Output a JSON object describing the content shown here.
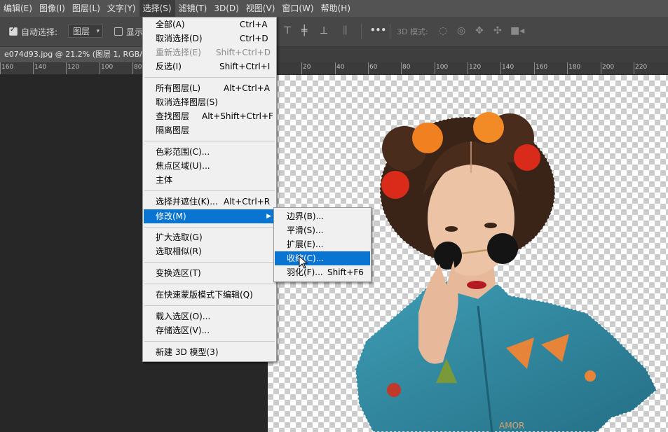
{
  "menubar": [
    "编辑(E)",
    "图像(I)",
    "图层(L)",
    "文字(Y)",
    "选择(S)",
    "滤镜(T)",
    "3D(D)",
    "视图(V)",
    "窗口(W)",
    "帮助(H)"
  ],
  "options": {
    "auto_select_label": "自动选择:",
    "layer_dropdown": "图层",
    "show_label": "显示",
    "mode_3d_label": "3D 模式:",
    "more": "•••"
  },
  "doc_tab": "e074d93.jpg @ 21.2% (图层 1, RGB/8) *",
  "ruler": {
    "left": [
      "160",
      "140",
      "120",
      "100",
      "80"
    ],
    "right": [
      "20",
      "40",
      "60",
      "80",
      "100",
      "120",
      "140",
      "160",
      "180",
      "200",
      "220"
    ]
  },
  "select_menu": {
    "items": [
      {
        "label": "全部(A)",
        "shortcut": "Ctrl+A"
      },
      {
        "label": "取消选择(D)",
        "shortcut": "Ctrl+D"
      },
      {
        "label": "重新选择(E)",
        "shortcut": "Shift+Ctrl+D",
        "disabled": true
      },
      {
        "label": "反选(I)",
        "shortcut": "Shift+Ctrl+I"
      },
      {
        "label": "所有图层(L)",
        "shortcut": "Alt+Ctrl+A"
      },
      {
        "label": "取消选择图层(S)",
        "shortcut": ""
      },
      {
        "label": "查找图层",
        "shortcut": "Alt+Shift+Ctrl+F"
      },
      {
        "label": "隔离图层",
        "shortcut": ""
      },
      {
        "label": "色彩范围(C)...",
        "shortcut": ""
      },
      {
        "label": "焦点区域(U)...",
        "shortcut": ""
      },
      {
        "label": "主体",
        "shortcut": ""
      },
      {
        "label": "选择并遮住(K)...",
        "shortcut": "Alt+Ctrl+R"
      },
      {
        "label": "修改(M)",
        "shortcut": "",
        "highlighted": true,
        "submenu": true
      },
      {
        "label": "扩大选取(G)",
        "shortcut": ""
      },
      {
        "label": "选取相似(R)",
        "shortcut": ""
      },
      {
        "label": "变换选区(T)",
        "shortcut": ""
      },
      {
        "label": "在快速蒙版模式下编辑(Q)",
        "shortcut": ""
      },
      {
        "label": "载入选区(O)...",
        "shortcut": ""
      },
      {
        "label": "存储选区(V)...",
        "shortcut": ""
      },
      {
        "label": "新建 3D 模型(3)",
        "shortcut": ""
      }
    ]
  },
  "modify_submenu": {
    "items": [
      {
        "label": "边界(B)...",
        "shortcut": ""
      },
      {
        "label": "平滑(S)...",
        "shortcut": ""
      },
      {
        "label": "扩展(E)...",
        "shortcut": ""
      },
      {
        "label": "收缩(C)...",
        "shortcut": "",
        "highlighted": true
      },
      {
        "label": "羽化(F)...",
        "shortcut": "Shift+F6"
      }
    ]
  },
  "photo_text": "AMOR",
  "colors": {
    "menu_highlight": "#0a74d2",
    "menubar_bg": "#535353",
    "options_bg": "#474747",
    "workspace_bg": "#282828"
  }
}
